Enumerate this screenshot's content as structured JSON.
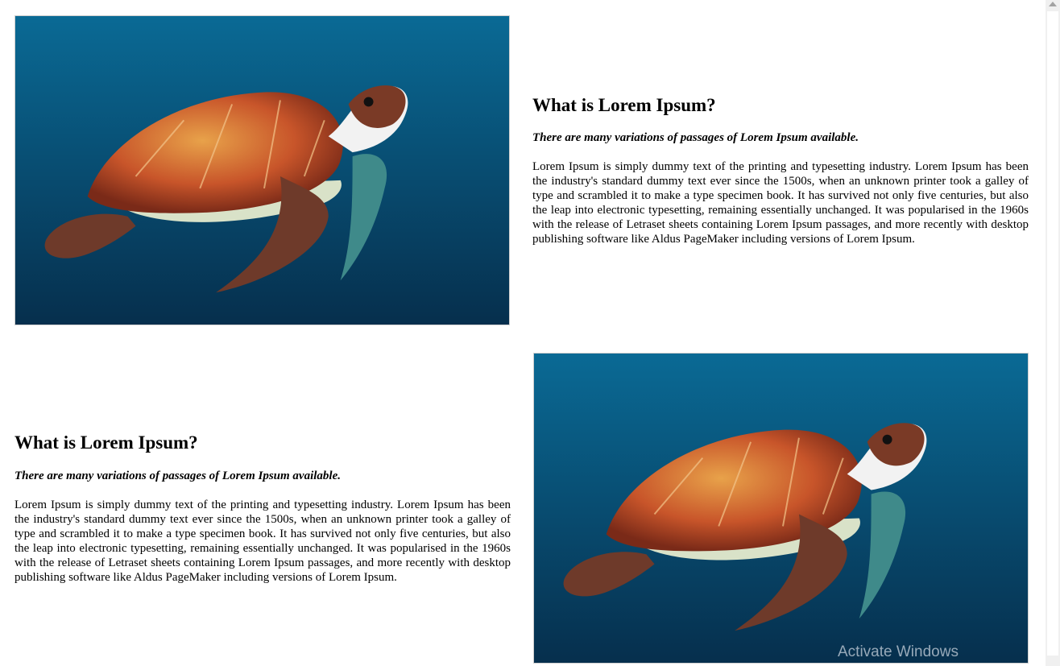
{
  "sections": [
    {
      "heading": "What is Lorem Ipsum?",
      "subheading": "There are many variations of passages of Lorem Ipsum available.",
      "body": "Lorem Ipsum is simply dummy text of the printing and typesetting industry. Lorem Ipsum has been the industry's standard dummy text ever since the 1500s, when an unknown printer took a galley of type and scrambled it to make a type specimen book. It has survived not only five centuries, but also the leap into electronic typesetting, remaining essentially unchanged. It was popularised in the 1960s with the release of Letraset sheets containing Lorem Ipsum passages, and more recently with desktop publishing software like Aldus PageMaker including versions of Lorem Ipsum.",
      "image_icon": "sea-turtle-photo"
    },
    {
      "heading": "What is Lorem Ipsum?",
      "subheading": "There are many variations of passages of Lorem Ipsum available.",
      "body": "Lorem Ipsum is simply dummy text of the printing and typesetting industry. Lorem Ipsum has been the industry's standard dummy text ever since the 1500s, when an unknown printer took a galley of type and scrambled it to make a type specimen book. It has survived not only five centuries, but also the leap into electronic typesetting, remaining essentially unchanged. It was popularised in the 1960s with the release of Letraset sheets containing Lorem Ipsum passages, and more recently with desktop publishing software like Aldus PageMaker including versions of Lorem Ipsum.",
      "image_icon": "sea-turtle-photo"
    }
  ],
  "watermark": "Activate Windows",
  "colors": {
    "ocean_top": "#0a6a95",
    "ocean_bottom": "#062f4d",
    "shell": "#c8552a",
    "skin": "#6e3a2a"
  }
}
